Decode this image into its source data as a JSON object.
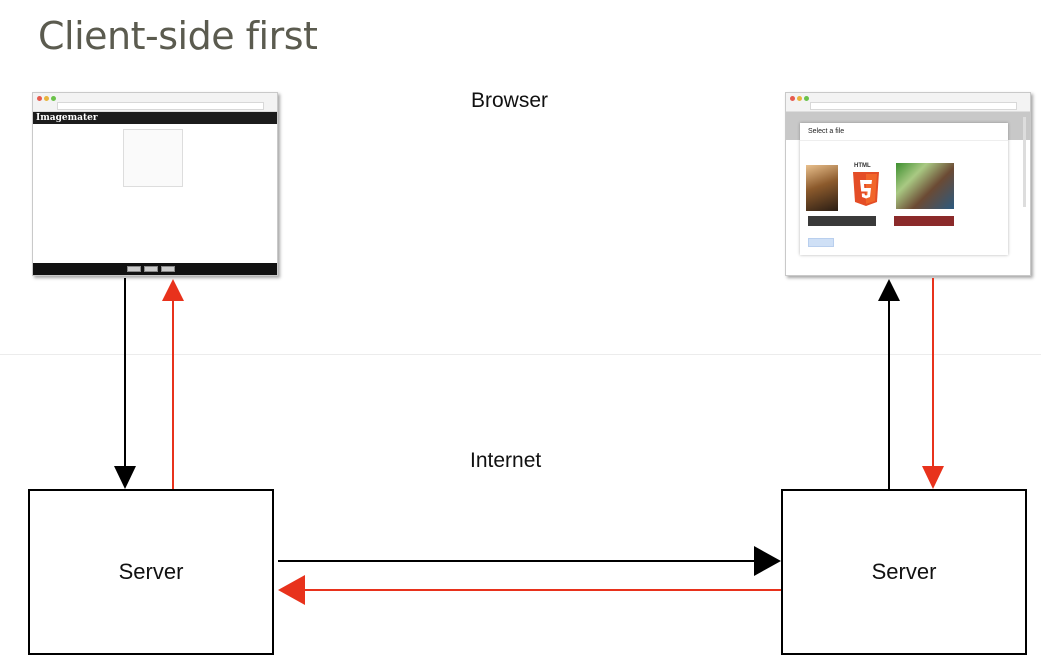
{
  "slide": {
    "title": "Client-side first",
    "browser_label": "Browser",
    "internet_label": "Internet"
  },
  "servers": {
    "left_label": "Server",
    "right_label": "Server"
  },
  "thumbnail_left": {
    "app_name": "Imagemater"
  },
  "thumbnail_right": {
    "dialog_title": "Select a file",
    "html5_label": "HTML"
  },
  "colors": {
    "request_arrow": "#000000",
    "response_arrow": "#e8321c",
    "title_text": "#5b5b4f"
  }
}
